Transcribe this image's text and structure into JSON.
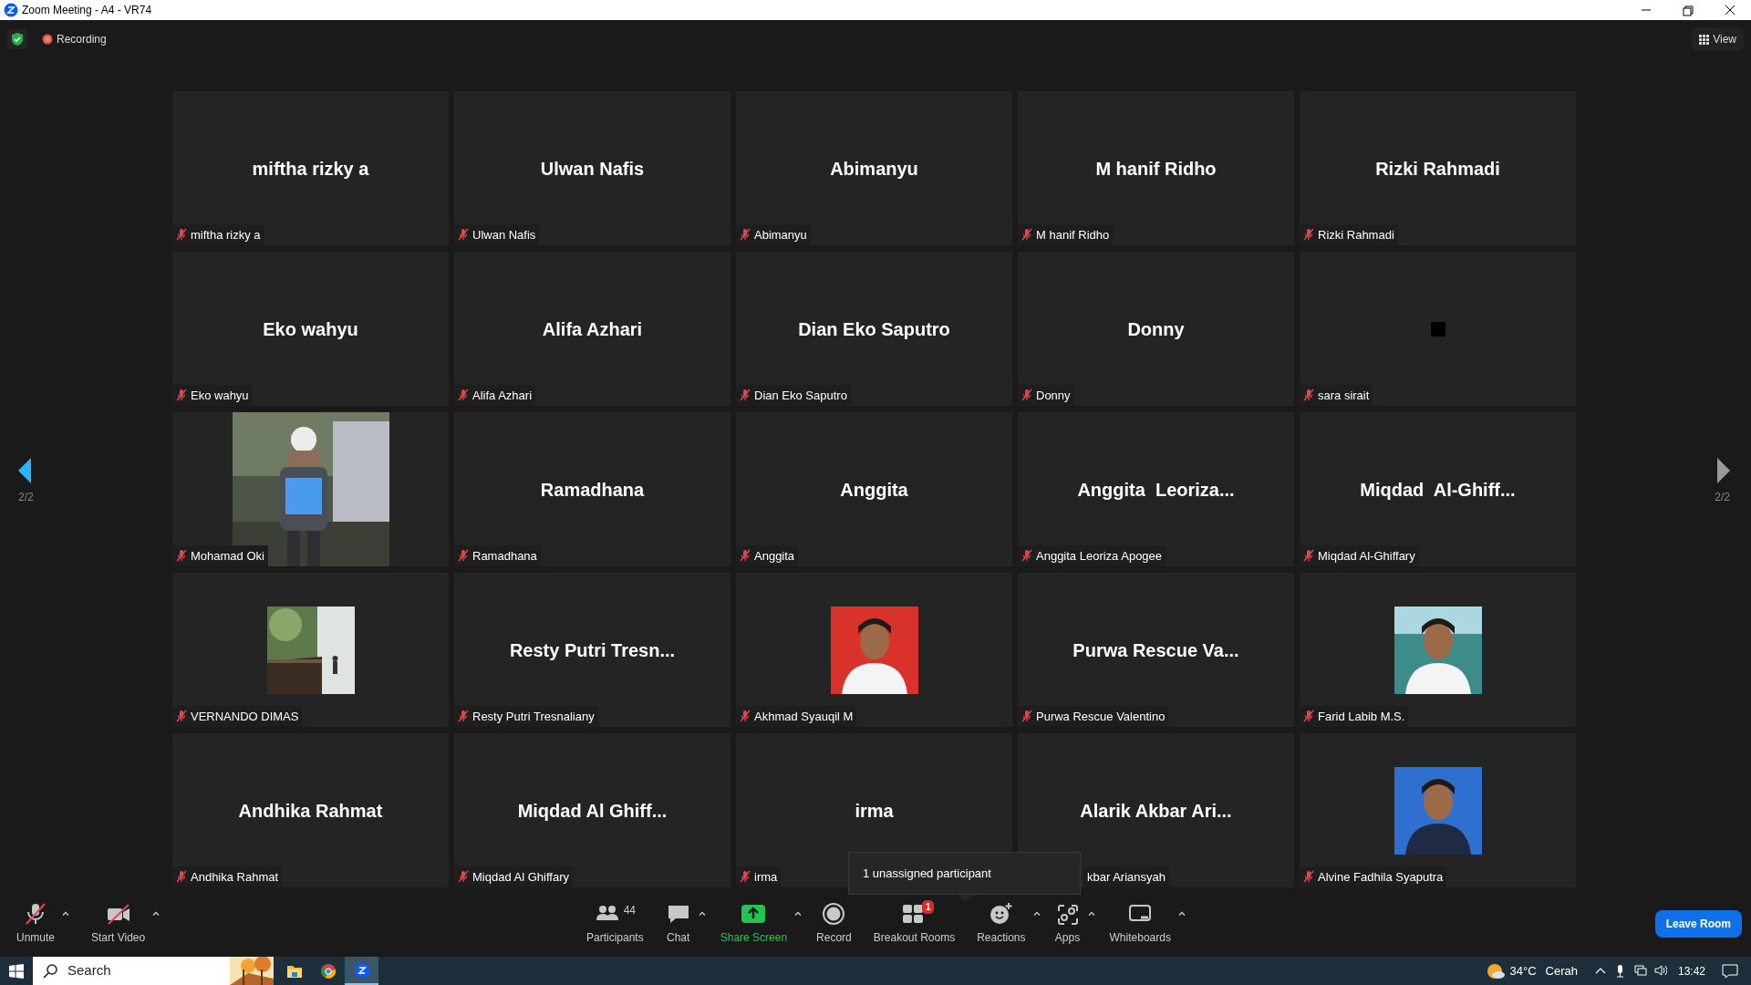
{
  "window": {
    "title": "Zoom Meeting - A4 - VR74"
  },
  "top_bar": {
    "recording_label": "Recording",
    "view_label": "View"
  },
  "pagination": [
    {
      "label": "2/2",
      "enabled": true
    },
    {
      "label": "2/2",
      "enabled": false
    }
  ],
  "tiles": [
    {
      "kind": "name",
      "display_name": "miftha rizky a",
      "label": "miftha rizky a",
      "muted": true
    },
    {
      "kind": "name",
      "display_name": "Ulwan Nafis",
      "label": "Ulwan Nafis",
      "muted": true
    },
    {
      "kind": "name",
      "display_name": "Abimanyu",
      "label": "Abimanyu",
      "muted": true
    },
    {
      "kind": "name",
      "display_name": "M hanif Ridho",
      "label": "M hanif Ridho",
      "muted": true
    },
    {
      "kind": "name",
      "display_name": "Rizki Rahmadi",
      "label": "Rizki Rahmadi",
      "muted": true
    },
    {
      "kind": "name",
      "display_name": "Eko wahyu",
      "label": "Eko wahyu",
      "muted": true
    },
    {
      "kind": "name",
      "display_name": "Alifa Azhari",
      "label": "Alifa Azhari",
      "muted": true
    },
    {
      "kind": "name",
      "display_name": "Dian Eko Saputro",
      "label": "Dian Eko Saputro",
      "muted": true
    },
    {
      "kind": "name",
      "display_name": "Donny",
      "label": "Donny",
      "muted": true
    },
    {
      "kind": "dark",
      "label": "sara sirait",
      "muted": true
    },
    {
      "kind": "video",
      "label": "Mohamad Oki",
      "muted": true
    },
    {
      "kind": "name",
      "display_name": "Ramadhana",
      "label": "Ramadhana",
      "muted": true
    },
    {
      "kind": "name",
      "display_name": "Anggita",
      "label": "Anggita",
      "muted": true
    },
    {
      "kind": "name",
      "display_name": "Anggita  Leoriza...",
      "label": "Anggita Leoriza Apogee",
      "muted": true
    },
    {
      "kind": "name",
      "display_name": "Miqdad  Al-Ghiff...",
      "label": "Miqdad Al-Ghiffary",
      "muted": true
    },
    {
      "kind": "avatar",
      "label": "VERNANDO DIMAS",
      "muted": true
    },
    {
      "kind": "name",
      "display_name": "Resty Putri Tresn...",
      "label": "Resty Putri Tresnaliany",
      "muted": true
    },
    {
      "kind": "avatar",
      "label": "Akhmad Syauqil M",
      "muted": true
    },
    {
      "kind": "name",
      "display_name": "Purwa Rescue Va...",
      "label": "Purwa Rescue Valentino",
      "muted": true
    },
    {
      "kind": "avatar",
      "label": "Farid Labib M.S.",
      "muted": true
    },
    {
      "kind": "name",
      "display_name": "Andhika Rahmat",
      "label": "Andhika Rahmat",
      "muted": true
    },
    {
      "kind": "name",
      "display_name": "Miqdad Al Ghiff...",
      "label": "Miqdad Al Ghiffary",
      "muted": true
    },
    {
      "kind": "name",
      "display_name": "irma",
      "label": "irma",
      "muted": true
    },
    {
      "kind": "name",
      "display_name": "Alarik Akbar Ari...",
      "label": "kbar Ariansyah",
      "label_covered": true
    },
    {
      "kind": "avatar",
      "label": "Alvine Fadhila Syaputra",
      "muted": true
    }
  ],
  "tooltip": {
    "text": "1 unassigned participant"
  },
  "toolbar": {
    "left": [
      {
        "kind": "mic",
        "label": "Unmute",
        "menu": true
      },
      {
        "kind": "video",
        "label": "Start Video",
        "menu": true
      }
    ],
    "center": [
      {
        "kind": "participants",
        "label": "Participants",
        "count": "44",
        "menu": false
      },
      {
        "kind": "chat",
        "label": "Chat",
        "menu": true
      },
      {
        "kind": "share",
        "label": "Share Screen",
        "menu": true
      },
      {
        "kind": "record",
        "label": "Record",
        "menu": false
      },
      {
        "kind": "breakout",
        "label": "Breakout Rooms",
        "badge": "1",
        "menu": false
      },
      {
        "kind": "reactions",
        "label": "Reactions",
        "menu": true
      },
      {
        "kind": "apps",
        "label": "Apps",
        "menu": true
      },
      {
        "kind": "whiteboards",
        "label": "Whiteboards",
        "menu": true
      }
    ],
    "leave_label": "Leave Room"
  },
  "taskbar": {
    "search_placeholder": "Search",
    "apps": [
      {
        "kind": "explorer",
        "selected": false
      },
      {
        "kind": "chrome",
        "selected": false
      },
      {
        "kind": "zoom",
        "selected": true
      }
    ],
    "weather_temp": "34°C",
    "weather_text": "Cerah",
    "time": "13:42"
  }
}
